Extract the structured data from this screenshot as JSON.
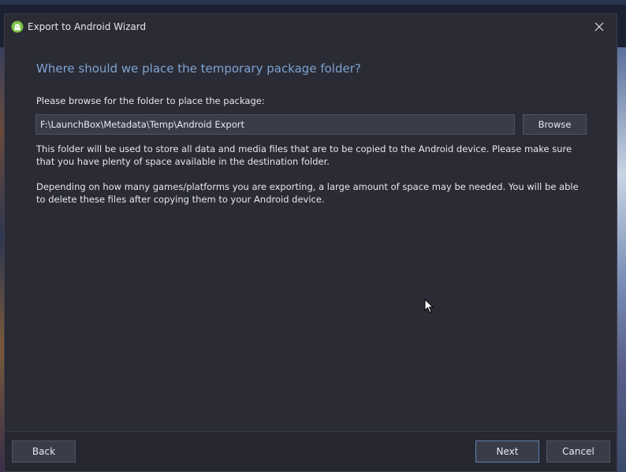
{
  "window": {
    "title": "Export to Android Wizard",
    "icon": "android-icon",
    "close_icon": "close-icon"
  },
  "content": {
    "heading": "Where should we place the temporary package folder?",
    "prompt": "Please browse for the folder to place the package:",
    "folder_path": "F:\\LaunchBox\\Metadata\\Temp\\Android Export",
    "browse_label": "Browse",
    "paragraph1": "This folder will be used to store all data and media files that are to be copied to the Android device. Please make sure that you have plenty of space available in the destination folder.",
    "paragraph2": "Depending on how many games/platforms you are exporting, a large amount of space may be needed. You will be able to delete these files after copying them to your Android device."
  },
  "footer": {
    "back_label": "Back",
    "next_label": "Next",
    "cancel_label": "Cancel"
  },
  "colors": {
    "window_bg": "#2a2b35",
    "heading": "#7ea3d0",
    "accent_border": "#5f7fb0",
    "android_green": "#7bc043"
  }
}
